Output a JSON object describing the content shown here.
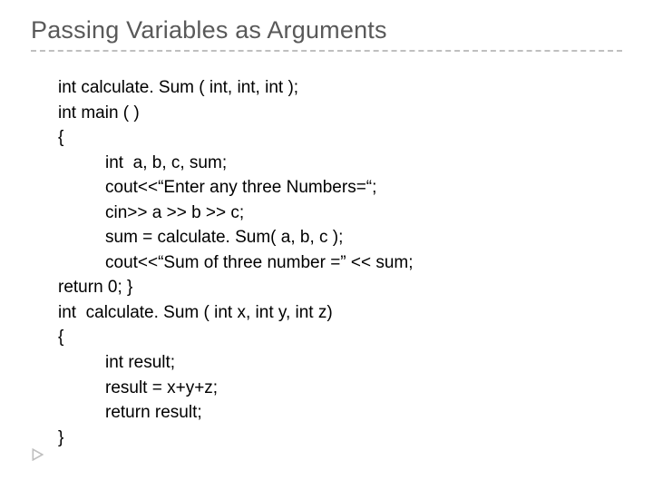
{
  "title": "Passing Variables as Arguments",
  "code": {
    "l1": "int calculate. Sum ( int, int, int );",
    "l2": "int main ( )",
    "l3": "{",
    "l4": "int  a, b, c, sum;",
    "l5": "cout<<“Enter any three Numbers=“;",
    "l6": "cin>> a >> b >> c;",
    "l7": "sum = calculate. Sum( a, b, c );",
    "l8": "cout<<“Sum of three number =” << sum;",
    "l9": "return 0; }",
    "l10": "int  calculate. Sum ( int x, int y, int z)",
    "l11": "{",
    "l12": "int result;",
    "l13": "result = x+y+z;",
    "l14": "return result;",
    "l15": "}"
  }
}
